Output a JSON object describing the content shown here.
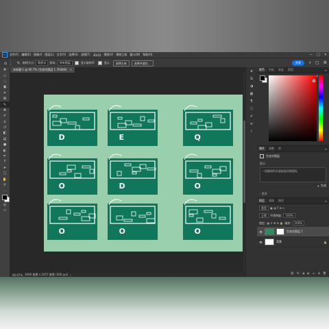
{
  "menubar": {
    "logo": "Ps",
    "items": [
      "文件(F)",
      "编辑(E)",
      "图像(I)",
      "图层(L)",
      "文字(Y)",
      "选择(S)",
      "滤镜(T)",
      "3D(D)",
      "视图(V)",
      "增效工具",
      "窗口(W)",
      "帮助(H)"
    ],
    "window_controls": [
      "—",
      "□",
      "✕"
    ]
  },
  "options": {
    "home_icon": "⌂",
    "tool_icon": "✎",
    "sample_label": "取样大小:",
    "sample_value": "取样点",
    "sample_all_label": "样本:",
    "sample_all_value": "所有图层",
    "show_ring_label": "显示取样环",
    "show_label": "显示",
    "select_subject_btn": "选择主体",
    "mask_btn": "选择并遮住...",
    "share_label": "共享",
    "right_icons": [
      "⌕",
      "▢",
      "⚙"
    ]
  },
  "document": {
    "tab_label": "未标题-1 @ 66.7% (生成式图层 1, RGB/8)",
    "tab_close": "✕"
  },
  "status": {
    "zoom": "66.67%",
    "info": "3000 像素 x 2457 像素 (300 ppi)",
    "arrow": "›"
  },
  "tools": [
    {
      "name": "move",
      "glyph": "✥"
    },
    {
      "name": "artboard",
      "glyph": "▭"
    },
    {
      "name": "lasso",
      "glyph": "◌"
    },
    {
      "name": "object-select",
      "glyph": "▣"
    },
    {
      "name": "crop",
      "glyph": "⌗"
    },
    {
      "name": "frame",
      "glyph": "⊠"
    },
    {
      "name": "eyedropper",
      "glyph": "✎"
    },
    {
      "name": "healing",
      "glyph": "✚"
    },
    {
      "name": "brush",
      "glyph": "✐"
    },
    {
      "name": "stamp",
      "glyph": "♙"
    },
    {
      "name": "history-brush",
      "glyph": "↺"
    },
    {
      "name": "eraser",
      "glyph": "◧"
    },
    {
      "name": "gradient",
      "glyph": "▤"
    },
    {
      "name": "blur",
      "glyph": "●"
    },
    {
      "name": "dodge",
      "glyph": "◐"
    },
    {
      "name": "pen",
      "glyph": "✒"
    },
    {
      "name": "type",
      "glyph": "T"
    },
    {
      "name": "path-select",
      "glyph": "➤"
    },
    {
      "name": "rectangle",
      "glyph": "□"
    },
    {
      "name": "hand",
      "glyph": "✋"
    },
    {
      "name": "zoom",
      "glyph": "⚲"
    },
    {
      "name": "more",
      "glyph": "…"
    }
  ],
  "extra_tools": [
    {
      "name": "quick-mask",
      "glyph": "◎"
    },
    {
      "name": "screen-mode",
      "glyph": "▭"
    }
  ],
  "iconstrip": [
    {
      "name": "history",
      "glyph": "⧖"
    },
    {
      "name": "properties",
      "glyph": "☰"
    },
    {
      "name": "adjust",
      "glyph": "◑"
    },
    {
      "name": "styles",
      "glyph": "▦"
    },
    {
      "name": "paragraph",
      "glyph": "¶"
    },
    {
      "name": "info",
      "glyph": "ⓘ"
    },
    {
      "name": "brushes",
      "glyph": "✐"
    },
    {
      "name": "channels",
      "glyph": "≋"
    },
    {
      "name": "paths",
      "glyph": "⌇"
    }
  ],
  "color_panel": {
    "tabs": [
      "颜色",
      "色板",
      "渐变",
      "图案"
    ],
    "menu_icon": "≡"
  },
  "props_panel": {
    "tabs": [
      "属性",
      "调整",
      "库"
    ],
    "menu_icon": "≡",
    "head_label": "生成式图层",
    "prompt_label": "提示",
    "prompt_text": "一组墨绿色名画插画风格图标",
    "generate_label": "生成",
    "more_label": "更多"
  },
  "layers_panel": {
    "tabs": [
      "图层",
      "通道",
      "路径"
    ],
    "menu_icon": "≡",
    "filter_label": "类型",
    "blend_mode": "正常",
    "opacity_label": "不透明度:",
    "opacity_value": "100%",
    "lock_label": "锁定:",
    "fill_label": "填充:",
    "fill_value": "100%",
    "layers": [
      {
        "name": "生成式图层 1",
        "selected": true
      },
      {
        "name": "背景",
        "selected": false
      }
    ],
    "footer_icons": [
      "⛓",
      "fx",
      "◑",
      "◐",
      "▭",
      "⊞",
      "🗑"
    ]
  },
  "canvas_art": {
    "background": "#9acfad",
    "card_color": "#11775a",
    "ink": "#ffffff",
    "cards": [
      {
        "row": 0,
        "col": 0,
        "letter": "D"
      },
      {
        "row": 0,
        "col": 1,
        "letter": "E"
      },
      {
        "row": 0,
        "col": 2,
        "letter": "Q"
      },
      {
        "row": 1,
        "col": 0,
        "letter": "O"
      },
      {
        "row": 1,
        "col": 1,
        "letter": "D"
      },
      {
        "row": 1,
        "col": 2,
        "letter": "O"
      },
      {
        "row": 2,
        "col": 0,
        "letter": "O"
      },
      {
        "row": 2,
        "col": 1,
        "letter": "O"
      },
      {
        "row": 2,
        "col": 2,
        "letter": "O"
      }
    ]
  }
}
